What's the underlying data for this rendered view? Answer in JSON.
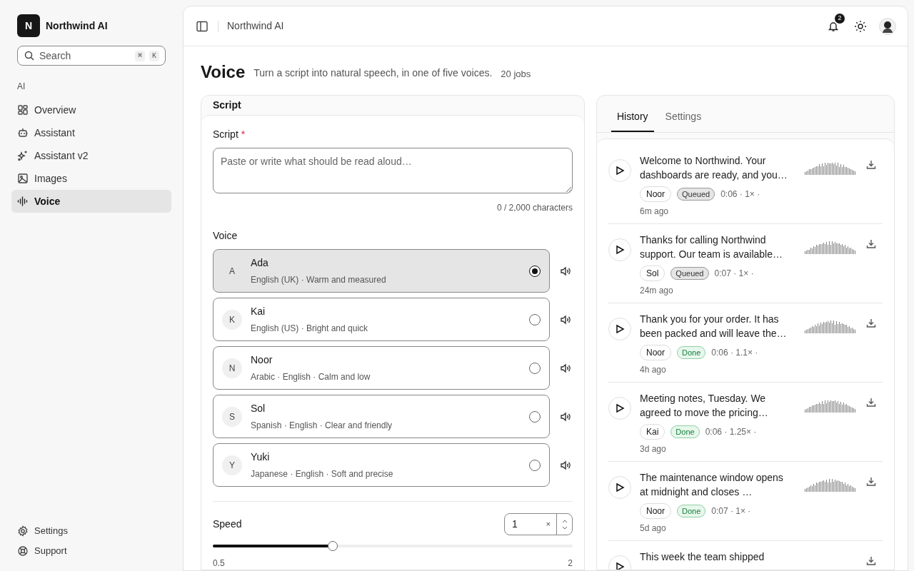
{
  "brand": {
    "initial": "N",
    "name": "Northwind AI"
  },
  "search": {
    "placeholder": "Search",
    "keys": [
      "⌘",
      "K"
    ]
  },
  "sidebar": {
    "section": "AI",
    "items": [
      {
        "label": "Overview",
        "selected": false
      },
      {
        "label": "Assistant",
        "selected": false
      },
      {
        "label": "Assistant v2",
        "selected": false
      },
      {
        "label": "Images",
        "selected": false
      },
      {
        "label": "Voice",
        "selected": true
      }
    ],
    "footer": [
      {
        "label": "Settings"
      },
      {
        "label": "Support"
      }
    ]
  },
  "header": {
    "breadcrumb": "Northwind AI",
    "notifications": "2"
  },
  "page": {
    "title": "Voice",
    "subtitle": "Turn a script into natural speech, in one of five voices.",
    "count": "20 jobs"
  },
  "script_card": {
    "title": "Script",
    "field_label": "Script",
    "required": "*",
    "placeholder": "Paste or write what should be read aloud…",
    "counter": "0 / 2,000 characters",
    "voice_label": "Voice",
    "voices": [
      {
        "initial": "A",
        "name": "Ada",
        "description": "English (UK) · Warm and measured",
        "selected": true
      },
      {
        "initial": "K",
        "name": "Kai",
        "description": "English (US) · Bright and quick",
        "selected": false
      },
      {
        "initial": "N",
        "name": "Noor",
        "description": "Arabic · English · Calm and low",
        "selected": false
      },
      {
        "initial": "S",
        "name": "Sol",
        "description": "Spanish · English · Clear and friendly",
        "selected": false
      },
      {
        "initial": "Y",
        "name": "Yuki",
        "description": "Japanese · English · Soft and precise",
        "selected": false
      }
    ],
    "speed": {
      "label": "Speed",
      "value": "1",
      "unit": "×",
      "level": 0.333,
      "min_label": "0.5",
      "max_label": "2"
    }
  },
  "tabs": [
    {
      "label": "History",
      "selected": true
    },
    {
      "label": "Settings",
      "selected": false
    }
  ],
  "history": [
    {
      "text": "Welcome to Northwind. Your dashboards are ready, and you…",
      "voice": "Noor",
      "status": "Queued",
      "kind": "queued",
      "meta": "0:06 · 1× ·",
      "time": "6m ago"
    },
    {
      "text": "Thanks for calling Northwind support. Our team is available…",
      "voice": "Sol",
      "status": "Queued",
      "kind": "queued",
      "meta": "0:07 · 1× ·",
      "time": "24m ago"
    },
    {
      "text": "Thank you for your order. It has been packed and will leave the…",
      "voice": "Noor",
      "status": "Done",
      "kind": "done",
      "meta": "0:06 · 1.1× ·",
      "time": "4h ago"
    },
    {
      "text": "Meeting notes, Tuesday. We agreed to move the pricing…",
      "voice": "Kai",
      "status": "Done",
      "kind": "done",
      "meta": "0:06 · 1.25× ·",
      "time": "3d ago"
    },
    {
      "text": "The maintenance window opens at midnight and closes …",
      "voice": "Noor",
      "status": "Done",
      "kind": "done",
      "meta": "0:07 · 1× ·",
      "time": "5d ago"
    },
    {
      "text": "This week the team shipped"
    }
  ]
}
